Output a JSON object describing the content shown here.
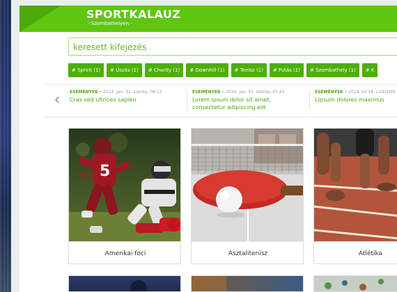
{
  "site": {
    "title": "SPORTKALAUZ",
    "subtitle": "- Szombathelyen -"
  },
  "search": {
    "placeholder": "keresett kifejezés"
  },
  "tags": [
    "# Sprint (1)",
    "# Úszás (1)",
    "# Charity (1)",
    "# Downhill (1)",
    "# Tenisz (1)",
    "# Futás (1)",
    "# Szombathely (1)",
    "# K"
  ],
  "news": [
    {
      "category": "ESEMÉNYEK",
      "meta": "2024. jan. 31. szerda, 08:12",
      "title": "Cras sed ultrices sapien"
    },
    {
      "category": "ESEMÉNYEK",
      "meta": "2024. jan. 31. szerda, 07:43",
      "title": "Lorem ipsum dolor sit amet, consectetur adipiscing elit"
    },
    {
      "category": "ESEMÉNYEK",
      "meta": "2024. júl 18. csütörtök",
      "title": "Lipsum dolores maximus"
    }
  ],
  "cards": [
    {
      "label": "Amerikai foci",
      "icon": "american-football-photo"
    },
    {
      "label": "Asztalitenisz",
      "icon": "table-tennis-photo"
    },
    {
      "label": "Atlétika",
      "icon": "athletics-photo"
    }
  ],
  "colors": {
    "brand": "#5fc610",
    "brand_dark": "#4caf08",
    "text_green": "#49a80b"
  }
}
